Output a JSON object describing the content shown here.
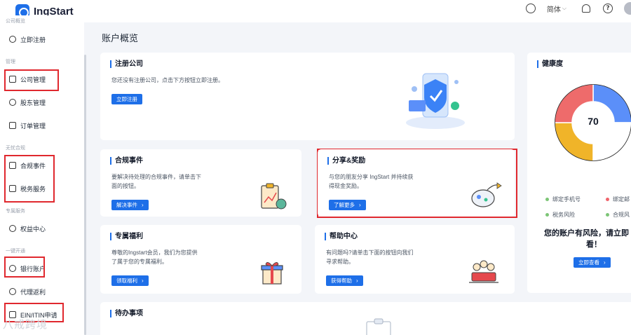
{
  "app": {
    "name": "IngStart"
  },
  "header": {
    "language": "简体"
  },
  "sidebar": {
    "sections": [
      {
        "title": "公司概览",
        "items": [
          {
            "label": "立即注册",
            "icon": "user-icon"
          }
        ]
      },
      {
        "title": "管理",
        "items": [
          {
            "label": "公司管理",
            "icon": "building-icon"
          },
          {
            "label": "股东管理",
            "icon": "people-icon"
          },
          {
            "label": "订单管理",
            "icon": "order-icon"
          }
        ]
      },
      {
        "title": "无忧合规",
        "items": [
          {
            "label": "合规事件",
            "icon": "checklist-icon"
          },
          {
            "label": "税务服务",
            "icon": "tax-icon"
          }
        ]
      },
      {
        "title": "专属服务",
        "items": [
          {
            "label": "权益中心",
            "icon": "badge-icon"
          }
        ]
      },
      {
        "title": "一键开通",
        "items": [
          {
            "label": "银行账户",
            "icon": "bank-icon"
          },
          {
            "label": "代理返利",
            "icon": "rebate-icon"
          },
          {
            "label": "EIN/ITIN申请",
            "icon": "document-icon"
          }
        ]
      }
    ]
  },
  "main": {
    "title": "账户概览",
    "register_card": {
      "title": "注册公司",
      "desc": "您还没有注册公司，点击下方按钮立即注册。",
      "button": "立即注册"
    },
    "compliance_card": {
      "title": "合规事件",
      "desc_line1": "要解决待处理的合规事件，请单击下",
      "desc_line2": "面的按钮。",
      "button": "解决事件"
    },
    "share_card": {
      "title": "分享&奖励",
      "desc_line1": "与您的朋友分享 IngStart 并持续获",
      "desc_line2": "得现金奖励。",
      "button": "了解更多"
    },
    "benefit_card": {
      "title": "专属福利",
      "desc_line1": "尊敬的Ingstart会员，我们为您提供",
      "desc_line2": "了属于您的专属福利。",
      "button": "领取福利"
    },
    "help_card": {
      "title": "帮助中心",
      "desc_line1": "有问题吗?请单击下面的按钮向我们",
      "desc_line2": "寻求帮助。",
      "button": "获得帮助"
    },
    "todo_card": {
      "title": "待办事项"
    }
  },
  "health": {
    "title": "健康度",
    "score": "70",
    "legend": [
      {
        "label": "绑定手机号",
        "color": "#7cc576"
      },
      {
        "label": "绑定邮",
        "color": "#f0646c"
      },
      {
        "label": "税务风险",
        "color": "#7cc576"
      },
      {
        "label": "合规风",
        "color": "#7cc576"
      }
    ],
    "risk_line1": "您的账户有风险，请立即",
    "risk_line2": "看！",
    "button": "立即查看",
    "donut": [
      {
        "value": 25,
        "color": "#5b8ff9"
      },
      {
        "value": 25,
        "color": "#ffffff"
      },
      {
        "value": 25,
        "color": "#f0b429"
      },
      {
        "value": 25,
        "color": "#ee6b6b"
      }
    ]
  },
  "watermark": "八戒跨境"
}
